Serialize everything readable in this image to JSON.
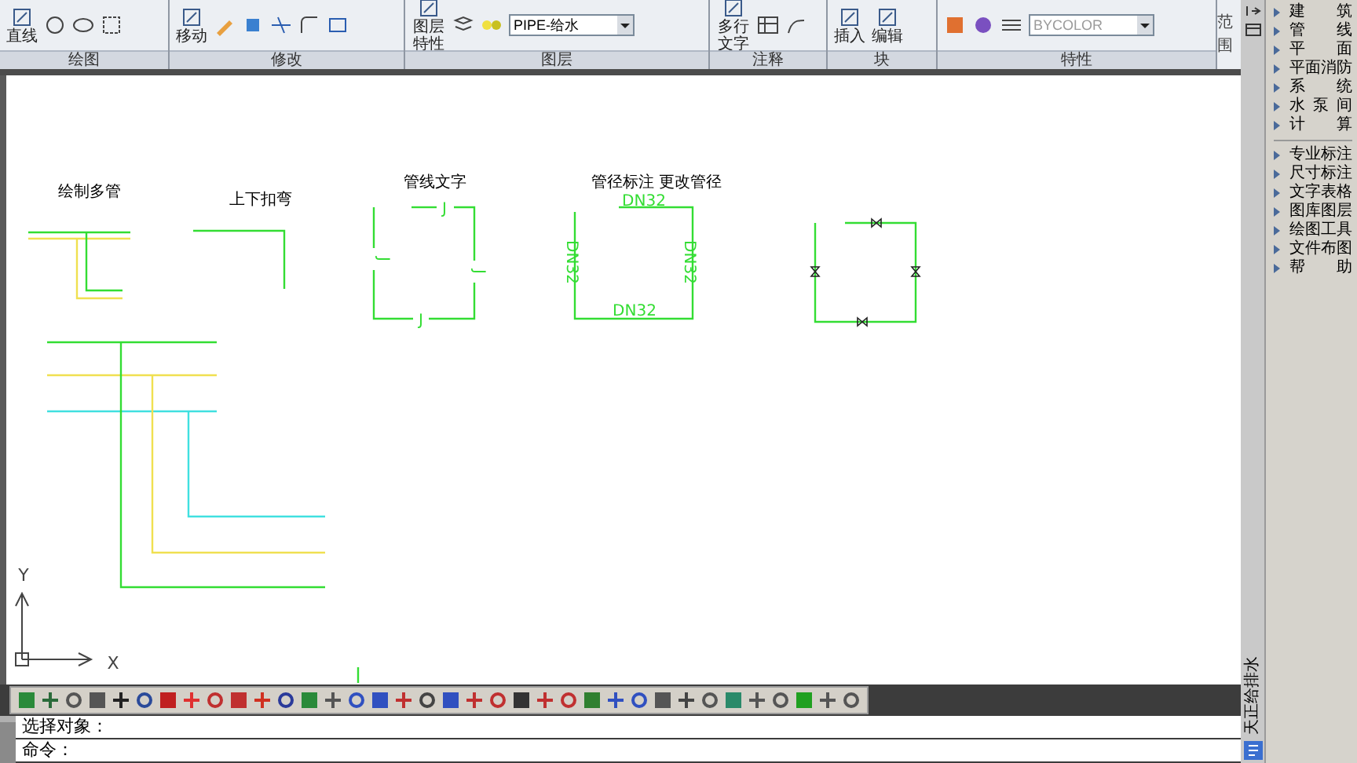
{
  "ribbon": {
    "panels": [
      {
        "title": "绘图",
        "tools": [
          {
            "label": "直线"
          }
        ]
      },
      {
        "title": "修改",
        "tools": [
          {
            "label": "移动"
          }
        ]
      },
      {
        "title": "图层",
        "tools": [
          {
            "label": "图层特性"
          }
        ],
        "dropdown": {
          "value": "PIPE-给水"
        }
      },
      {
        "title": "注释",
        "tools": [
          {
            "label": "多行文字"
          }
        ]
      },
      {
        "title": "块",
        "tools": [
          {
            "label": "插入"
          },
          {
            "label": "编辑"
          }
        ]
      },
      {
        "title": "特性",
        "dropdown": {
          "value": "BYCOLOR"
        }
      }
    ],
    "extra_label": "范围"
  },
  "canvas": {
    "captions": [
      "绘制多管",
      "上下扣弯",
      "管线文字",
      "管径标注 更改管径"
    ],
    "pipe_marks": [
      "J",
      "J",
      "J",
      "J"
    ],
    "size_marks": [
      "DN32",
      "DN32",
      "DN32",
      "DN32"
    ],
    "axes": {
      "x": "X",
      "y": "Y"
    }
  },
  "command_lines": [
    "选择对象：",
    "命令："
  ],
  "panel_tab": "天正给排水",
  "menu_groups": [
    [
      "建 筑",
      "管 线",
      "平 面",
      "平面消防",
      "系 统",
      "水泵间",
      "计 算"
    ],
    [
      "专业标注",
      "尺寸标注",
      "文字表格",
      "图库图层",
      "绘图工具",
      "文件布图",
      "帮 助"
    ]
  ]
}
